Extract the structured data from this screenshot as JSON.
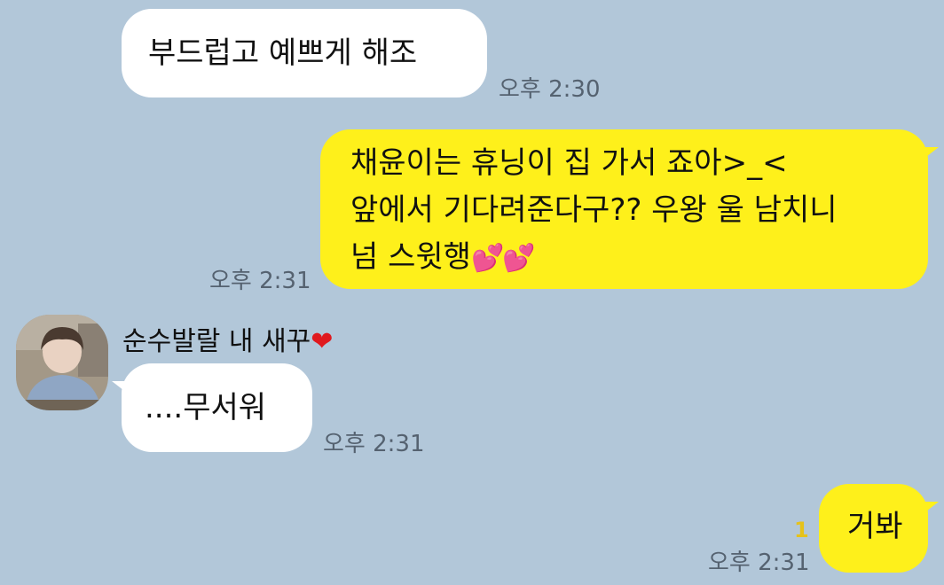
{
  "messages": [
    {
      "text": "부드럽고 예쁘게 해조",
      "time": "오후 2:30"
    },
    {
      "lines": [
        "채윤이는 휴닝이 집 가서 죠아>_<",
        "앞에서 기다려준다구?? 우왕 울 남치니",
        "넘 스윗행"
      ],
      "hearts": "💕💕",
      "time": "오후 2:31"
    },
    {
      "sender": "순수발랄 내 새꾸",
      "sender_heart": "❤",
      "text": "....무서워",
      "time": "오후 2:31"
    },
    {
      "text": "거봐",
      "unread": "1",
      "time": "오후 2:31"
    }
  ],
  "colors": {
    "background": "#b2c7d9",
    "incoming": "#ffffff",
    "outgoing": "#fef01b"
  },
  "icons": {
    "avatar": "profile-photo"
  }
}
